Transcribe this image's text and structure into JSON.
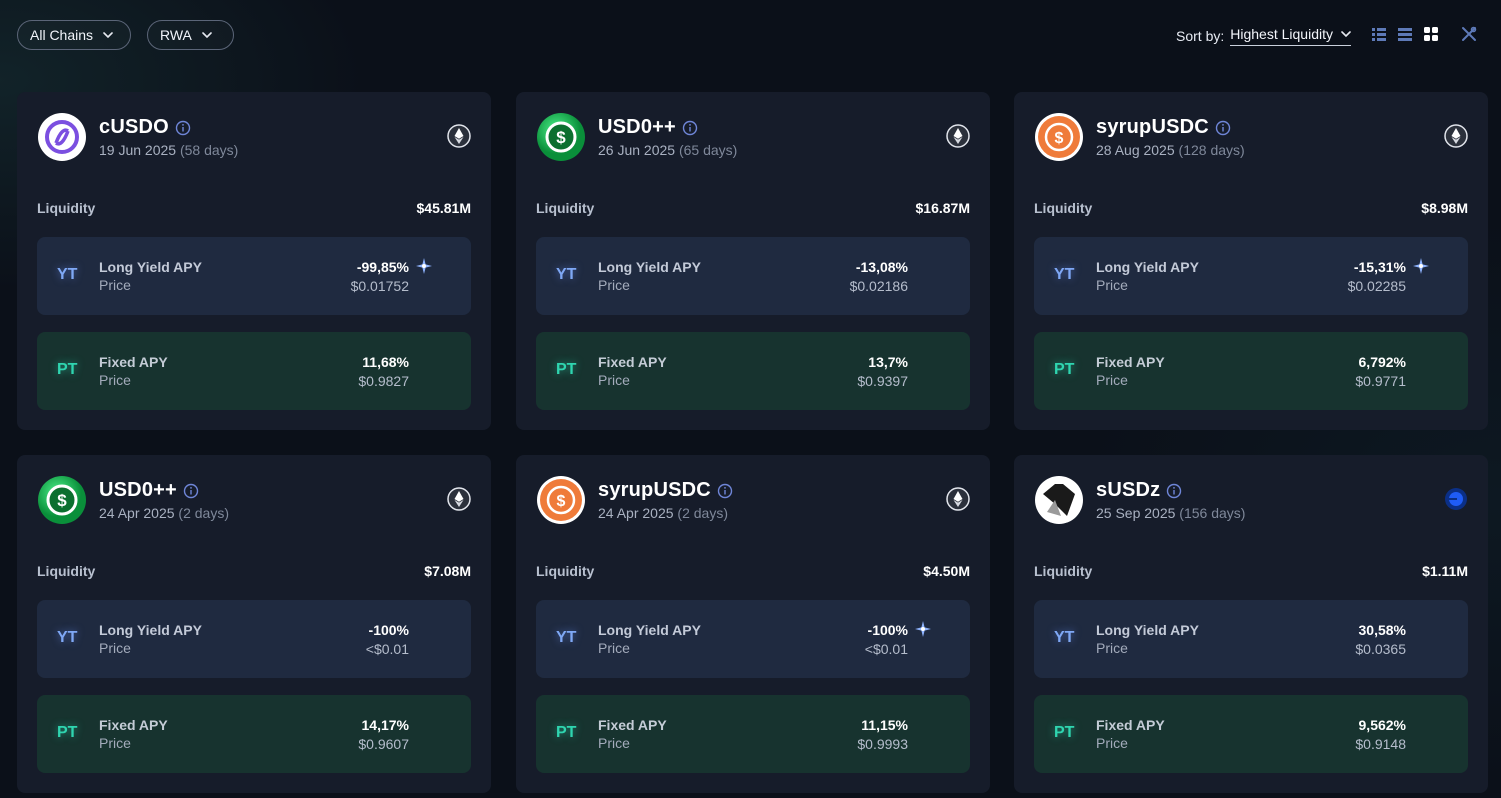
{
  "filters": {
    "chains_label": "All Chains",
    "category_label": "RWA"
  },
  "sort": {
    "label": "Sort by:",
    "value": "Highest Liquidity"
  },
  "view_modes": [
    "list-compact-icon",
    "list-icon",
    "grid-icon",
    "tools-icon"
  ],
  "colors": {
    "yt_accent": "#7fa8f5",
    "pt_accent": "#2fd5b0",
    "card_bg": "#161c2a",
    "page_bg": "#0b1019"
  },
  "cards": [
    {
      "name": "cUSDO",
      "date": "19 Jun 2025",
      "days": "(58 days)",
      "logo": "cusdo-logo",
      "chain": "ethereum-icon",
      "liquidity_label": "Liquidity",
      "liquidity": "$45.81M",
      "yt": {
        "tag": "YT",
        "label": "Long Yield APY",
        "sub": "Price",
        "apy": "-99,85%",
        "price": "$0.01752",
        "sparkle": true
      },
      "pt": {
        "tag": "PT",
        "label": "Fixed APY",
        "sub": "Price",
        "apy": "11,68%",
        "price": "$0.9827"
      }
    },
    {
      "name": "USD0++",
      "date": "26 Jun 2025",
      "days": "(65 days)",
      "logo": "usd0-logo",
      "chain": "ethereum-icon",
      "liquidity_label": "Liquidity",
      "liquidity": "$16.87M",
      "yt": {
        "tag": "YT",
        "label": "Long Yield APY",
        "sub": "Price",
        "apy": "-13,08%",
        "price": "$0.02186",
        "sparkle": false
      },
      "pt": {
        "tag": "PT",
        "label": "Fixed APY",
        "sub": "Price",
        "apy": "13,7%",
        "price": "$0.9397"
      }
    },
    {
      "name": "syrupUSDC",
      "date": "28 Aug 2025",
      "days": "(128 days)",
      "logo": "syrupusdc-logo",
      "chain": "ethereum-icon",
      "liquidity_label": "Liquidity",
      "liquidity": "$8.98M",
      "yt": {
        "tag": "YT",
        "label": "Long Yield APY",
        "sub": "Price",
        "apy": "-15,31%",
        "price": "$0.02285",
        "sparkle": true
      },
      "pt": {
        "tag": "PT",
        "label": "Fixed APY",
        "sub": "Price",
        "apy": "6,792%",
        "price": "$0.9771"
      }
    },
    {
      "name": "USD0++",
      "date": "24 Apr 2025",
      "days": "(2 days)",
      "logo": "usd0-logo",
      "chain": "ethereum-icon",
      "liquidity_label": "Liquidity",
      "liquidity": "$7.08M",
      "yt": {
        "tag": "YT",
        "label": "Long Yield APY",
        "sub": "Price",
        "apy": "-100%",
        "price": "<$0.01",
        "sparkle": false
      },
      "pt": {
        "tag": "PT",
        "label": "Fixed APY",
        "sub": "Price",
        "apy": "14,17%",
        "price": "$0.9607"
      }
    },
    {
      "name": "syrupUSDC",
      "date": "24 Apr 2025",
      "days": "(2 days)",
      "logo": "syrupusdc-logo",
      "chain": "ethereum-icon",
      "liquidity_label": "Liquidity",
      "liquidity": "$4.50M",
      "yt": {
        "tag": "YT",
        "label": "Long Yield APY",
        "sub": "Price",
        "apy": "-100%",
        "price": "<$0.01",
        "sparkle": true
      },
      "pt": {
        "tag": "PT",
        "label": "Fixed APY",
        "sub": "Price",
        "apy": "11,15%",
        "price": "$0.9993"
      }
    },
    {
      "name": "sUSDz",
      "date": "25 Sep 2025",
      "days": "(156 days)",
      "logo": "susdz-logo",
      "chain": "base-icon",
      "liquidity_label": "Liquidity",
      "liquidity": "$1.11M",
      "yt": {
        "tag": "YT",
        "label": "Long Yield APY",
        "sub": "Price",
        "apy": "30,58%",
        "price": "$0.0365",
        "sparkle": false
      },
      "pt": {
        "tag": "PT",
        "label": "Fixed APY",
        "sub": "Price",
        "apy": "9,562%",
        "price": "$0.9148"
      }
    }
  ]
}
